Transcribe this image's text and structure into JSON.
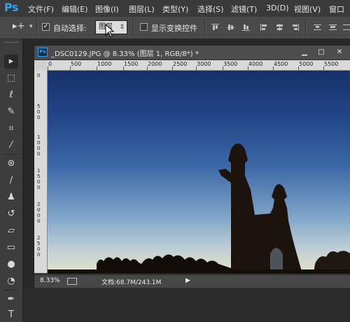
{
  "app": {
    "logo": "Ps"
  },
  "menu": [
    "文件(F)",
    "编辑(E)",
    "图像(I)",
    "图层(L)",
    "类型(Y)",
    "选择(S)",
    "滤镜(T)",
    "3D(D)",
    "视图(V)",
    "窗口"
  ],
  "options": {
    "auto_select_label": "自动选择:",
    "auto_select_value": "图层",
    "show_transform_label": "显示变换控件"
  },
  "document": {
    "title": "_DSC0129.JPG @ 8.33% (图层 1, RGB/8*) *",
    "ruler_marks": [
      "0",
      "500",
      "1000",
      "1500",
      "2000",
      "2500",
      "3000",
      "3500",
      "4000",
      "4500",
      "5000",
      "5500"
    ],
    "vertical_ruler_marks": [
      "0",
      "500",
      "1000",
      "1500",
      "2000",
      "2500"
    ],
    "zoom": "8.33%",
    "doc_size": "文档:68.7M/243.1M"
  },
  "tools": [
    "move-tool",
    "marquee-tool",
    "lasso-tool",
    "quick-select-tool",
    "crop-tool",
    "eyedropper-tool",
    "healing-brush-tool",
    "brush-tool",
    "clone-stamp-tool",
    "history-brush-tool",
    "eraser-tool",
    "gradient-tool",
    "blur-tool",
    "dodge-tool",
    "pen-tool",
    "type-tool",
    "path-select-tool"
  ]
}
